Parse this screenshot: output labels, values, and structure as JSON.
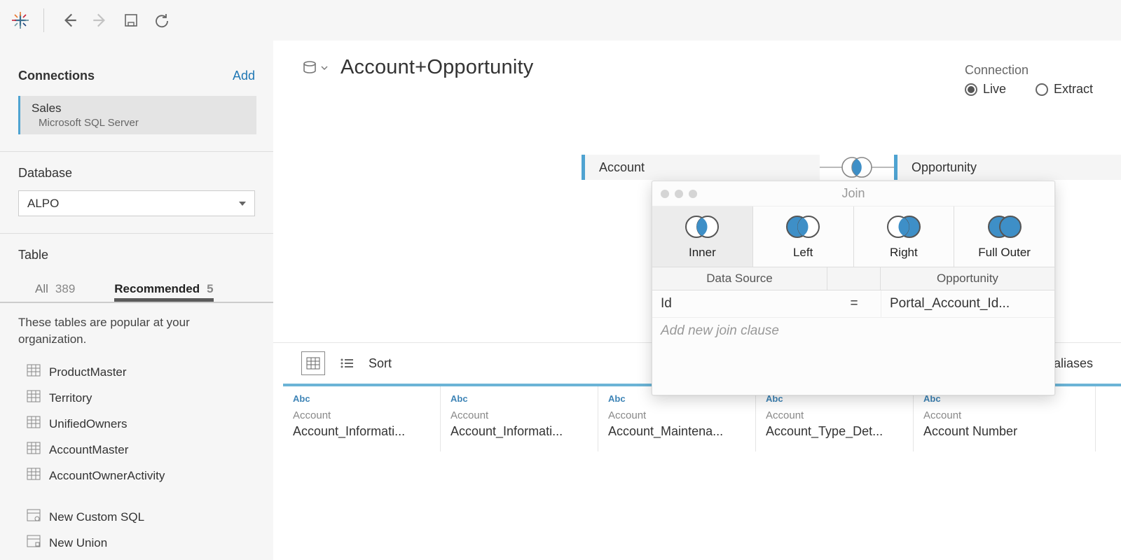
{
  "sidebar": {
    "connections_label": "Connections",
    "add_label": "Add",
    "connection": {
      "name": "Sales",
      "type": "Microsoft SQL Server"
    },
    "database_label": "Database",
    "database_value": "ALPO",
    "table_label": "Table",
    "tabs": {
      "all_label": "All",
      "all_count": "389",
      "rec_label": "Recommended",
      "rec_count": "5"
    },
    "hint": "These tables are popular at your organization.",
    "tables": [
      "ProductMaster",
      "Territory",
      "UnifiedOwners",
      "AccountMaster",
      "AccountOwnerActivity"
    ],
    "new_custom_sql": "New Custom SQL",
    "new_union": "New Union"
  },
  "datasource": {
    "title": "Account+Opportunity",
    "conn_label": "Connection",
    "live_label": "Live",
    "extract_label": "Extract"
  },
  "canvas": {
    "left_table": "Account",
    "right_table": "Opportunity"
  },
  "midbar": {
    "sort_label": "Sort",
    "show_aliases": "Show aliases"
  },
  "columns": [
    {
      "type": "Abc",
      "source": "Account",
      "name": "Account_Informati..."
    },
    {
      "type": "Abc",
      "source": "Account",
      "name": "Account_Informati..."
    },
    {
      "type": "Abc",
      "source": "Account",
      "name": "Account_Maintena..."
    },
    {
      "type": "Abc",
      "source": "Account",
      "name": "Account_Type_Det..."
    },
    {
      "type": "Abc",
      "source": "Account",
      "name": "Account Number"
    }
  ],
  "join": {
    "title": "Join",
    "types": [
      "Inner",
      "Left",
      "Right",
      "Full Outer"
    ],
    "header_left": "Data Source",
    "header_right": "Opportunity",
    "row": {
      "left": "Id",
      "op": "=",
      "right": "Portal_Account_Id..."
    },
    "add_clause": "Add new join clause"
  }
}
